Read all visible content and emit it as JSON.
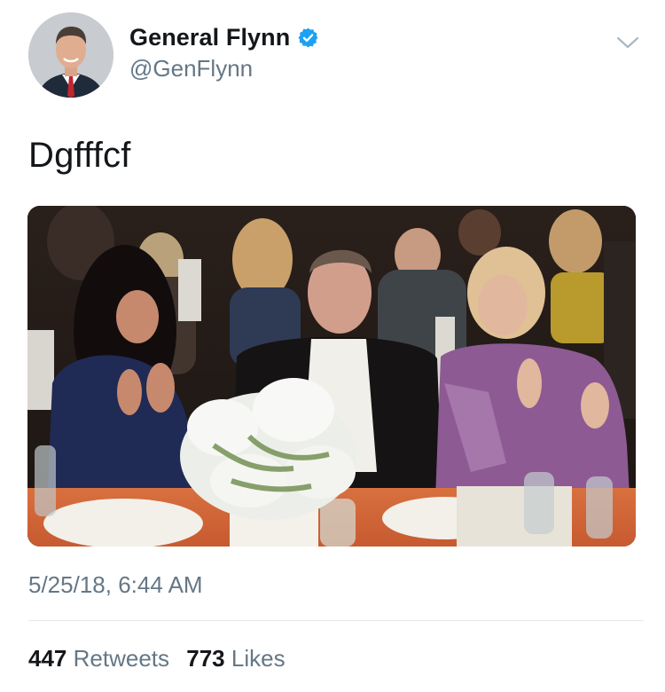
{
  "account": {
    "display_name": "General Flynn",
    "handle": "@GenFlynn",
    "verified_icon": "verified-badge-icon",
    "avatar_icon": "profile-photo"
  },
  "tweet": {
    "text": "Dgfffcf",
    "timestamp": "5/25/18, 6:44 AM",
    "media": "photo-dinner-party"
  },
  "stats": {
    "retweets_count": "447",
    "retweets_label": "Retweets",
    "likes_count": "773",
    "likes_label": "Likes"
  },
  "colors": {
    "text_primary": "#14171a",
    "text_secondary": "#657786",
    "verified_blue": "#1da1f2",
    "divider": "#e1e8ed"
  }
}
